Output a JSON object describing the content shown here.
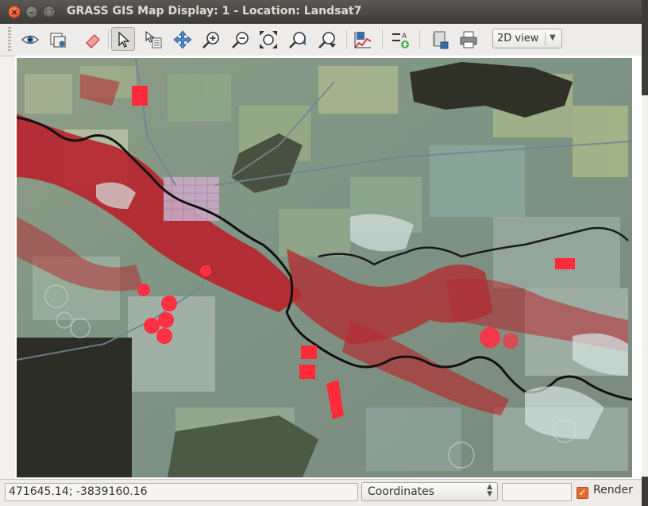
{
  "window": {
    "title": "GRASS GIS Map Display: 1  - Location: Landsat7"
  },
  "window_controls": {
    "close": "×",
    "minimize": "–",
    "maximize": "□"
  },
  "toolbar": {
    "tools": [
      {
        "name": "display-map-icon"
      },
      {
        "name": "render-map-icon"
      },
      {
        "name": "erase-display-icon"
      },
      {
        "name": "pointer-icon",
        "active": true
      },
      {
        "name": "query-icon"
      },
      {
        "name": "pan-icon"
      },
      {
        "name": "zoom-in-icon"
      },
      {
        "name": "zoom-out-icon"
      },
      {
        "name": "zoom-extent-icon"
      },
      {
        "name": "zoom-back-icon"
      },
      {
        "name": "zoom-menu-icon"
      },
      {
        "name": "analyze-icon"
      },
      {
        "name": "decoration-icon"
      },
      {
        "name": "save-map-icon"
      },
      {
        "name": "print-icon"
      }
    ],
    "view_mode": "2D view"
  },
  "statusbar": {
    "coordinates": "471645.14; -3839160.16",
    "display_mode": "Coordinates",
    "render_label": "Render",
    "render_checked": true
  },
  "colors": {
    "titlebar": "#3c3b37",
    "accent_checkbox": "#e9682e",
    "vegetation_red": "#b8232c",
    "river": "#111111"
  }
}
